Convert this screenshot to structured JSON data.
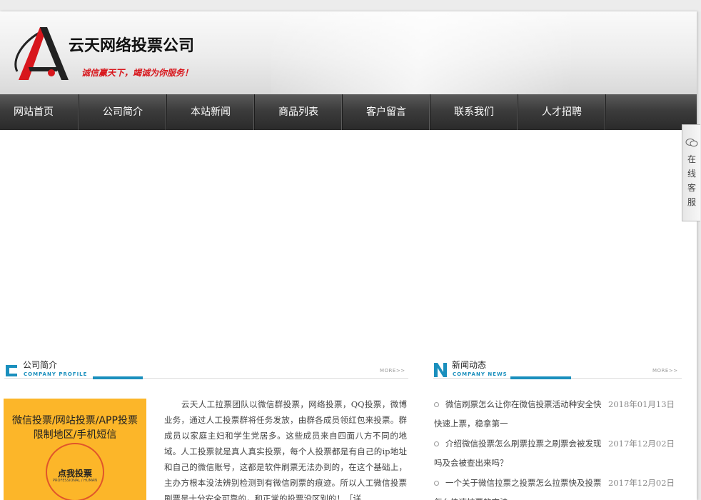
{
  "header": {
    "company_name": "云天网络投票公司",
    "slogan": "诚信赢天下，竭诚为你服务！"
  },
  "nav": [
    {
      "label": "网站首页"
    },
    {
      "label": "公司简介"
    },
    {
      "label": "本站新闻"
    },
    {
      "label": "商品列表"
    },
    {
      "label": "客户留言"
    },
    {
      "label": "联系我们"
    },
    {
      "label": "人才招聘"
    }
  ],
  "floating_service": {
    "label": "在线客服"
  },
  "profile": {
    "title": "公司简介",
    "subtitle": "COMPANY PROFILE",
    "more": "MORE>>",
    "image_line1": "微信投票/网站投票/APP投票",
    "image_line2": "限制地区/手机短信",
    "image_cta": "点我投票",
    "image_cta_en": "PROFESSIONAL / HUMAN",
    "text": "云天人工拉票团队以微信群投票，网络投票，QQ投票，微博业务，通过人工投票群将任务发放，由群各成员领红包来投票。群成员以家庭主妇和学生党居多。这些成员来自四面八方不同的地域。人工投票就是真人真实投票，每个人投票都是有自己的ip地址和自己的微信账号，这都是软件刷票无法办到的，在这个基础上，主办方根本没法辨别检测到有微信刷票的痕迹。所以人工微信投票刷票是十分安全可靠的，和正常的投票没区别的！［详"
  },
  "news": {
    "title": "新闻动态",
    "subtitle": "COMPANY NEWS",
    "more": "MORE>>",
    "items": [
      {
        "text": "微信刷票怎么让你在微信投票活动种安全快快速上票，稳拿第一",
        "date": "2018年01月13日"
      },
      {
        "text": "介绍微信投票怎么刷票拉票之刷票会被发现吗及会被查出来吗？",
        "date": "2017年12月02日"
      },
      {
        "text": "一个关于微信拉票之投票怎么拉票快及投票怎么快速拉票的方法",
        "date": "2017年12月02日"
      }
    ]
  },
  "colors": {
    "accent_blue": "#1a8fbd",
    "logo_red": "#d8161c",
    "nav_bg": "#3c3c3c",
    "promo_yellow": "#fcb629"
  }
}
